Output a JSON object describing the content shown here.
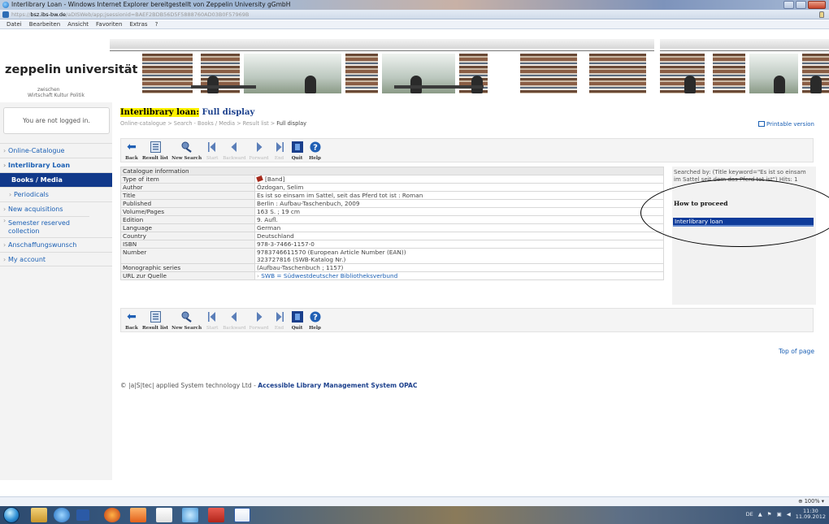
{
  "window": {
    "title": "Interlibrary Loan - Windows Internet Explorer bereitgestellt von Zeppelin University gGmbH",
    "url_prefix": "https://",
    "url_host": "bsz.ibs-bw.de",
    "url_rest": "/aDISWeb/app;jsessionid=BAEF2BDB56D5F5888760AD03B0F57969B"
  },
  "menu": [
    "Datei",
    "Bearbeiten",
    "Ansicht",
    "Favoriten",
    "Extras",
    "?"
  ],
  "header": {
    "logo": "zeppelin universität",
    "sub1": "zwischen",
    "sub2": "Wirtschaft Kultur Politik"
  },
  "sidebar": {
    "login": "You are not logged in.",
    "items": [
      {
        "label": "Online-Catalogue"
      },
      {
        "label": "Interlibrary Loan"
      },
      {
        "label": "Books / Media"
      },
      {
        "label": "Periodicals"
      },
      {
        "label": "New acquisitions"
      },
      {
        "label": "Semester reserved collection"
      },
      {
        "label": "Anschaffungswunsch"
      },
      {
        "label": "My account"
      }
    ]
  },
  "main": {
    "title_highlight": "Interlibrary loan:",
    "title_rest": "Full display",
    "breadcrumb": [
      "Online-catalogue",
      "Search - Books / Media",
      "Result list",
      "Full display"
    ],
    "printable": "Printable version",
    "toolbar": {
      "back": "Back",
      "result_list": "Result list",
      "new_search": "New Search",
      "start": "Start",
      "backward": "Backward",
      "forward": "Forward",
      "end": "End",
      "quit": "Quit",
      "help": "Help"
    },
    "catalogue": {
      "header": "Catalogue information",
      "rows": [
        {
          "key": "Type of item",
          "value": "[Band]"
        },
        {
          "key": "Author",
          "value": "Özdogan, Selim"
        },
        {
          "key": "Title",
          "value": "Es ist so einsam im Sattel, seit das Pferd tot ist : Roman"
        },
        {
          "key": "Published",
          "value": "Berlin : Aufbau-Taschenbuch, 2009"
        },
        {
          "key": "Volume/Pages",
          "value": "163 S. ; 19 cm"
        },
        {
          "key": "Edition",
          "value": "9. Aufl."
        },
        {
          "key": "Language",
          "value": "German"
        },
        {
          "key": "Country",
          "value": "Deutschland"
        },
        {
          "key": "ISBN",
          "value": "978-3-7466-1157-0"
        },
        {
          "key": "Number",
          "value": "9783746611570  (European Article Number (EAN))",
          "value2": "323727816  (SWB-Katalog Nr.)"
        },
        {
          "key": "Monographic series",
          "value": "(Aufbau-Taschenbuch ; 1157)"
        },
        {
          "key": "URL zur Quelle",
          "value": "SWB = Südwestdeutscher Bibliotheksverbund"
        }
      ]
    },
    "right_panel": {
      "searched_by": "Searched by: (Title keyword=\"Es ist so einsam im Sattel seit dem das Pferd tot ist\") Hits: 1",
      "how_to_proceed": "How to proceed",
      "interlibrary_loan": "Interlibrary loan"
    },
    "top_of_page": "Top of page",
    "footer_prefix": "© |a|S|tec| applied System technology Ltd - ",
    "footer_bold": "Accessible Library Management System OPAC"
  },
  "statusbar": {
    "zoom": "100%"
  },
  "taskbar": {
    "lang": "DE",
    "time": "11:30",
    "date": "11.09.2012"
  }
}
